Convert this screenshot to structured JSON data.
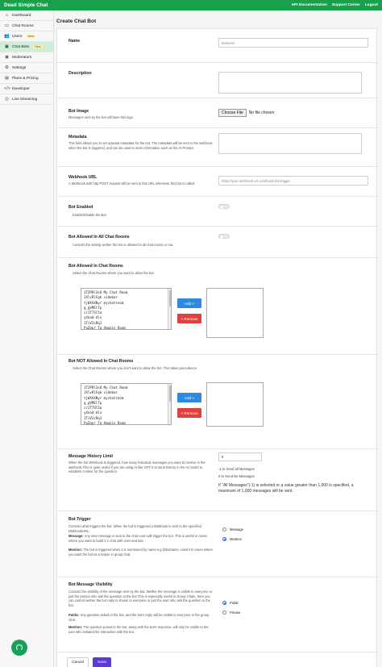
{
  "header": {
    "brand": "Dead Simple Chat",
    "nav": [
      "API Documentation",
      "Support Center",
      "Logout"
    ]
  },
  "sidebar": {
    "items": [
      {
        "icon": "home-icon",
        "glyph": "⌂",
        "label": "Dashboard",
        "badge": ""
      },
      {
        "icon": "chat-rooms-icon",
        "glyph": "▭",
        "label": "Chat Rooms",
        "badge": ""
      },
      {
        "icon": "users-icon",
        "glyph": "👥",
        "label": "Users",
        "badge": "New"
      },
      {
        "icon": "bot-icon",
        "glyph": "▣",
        "label": "Chat Bots",
        "badge": "New",
        "active": true
      },
      {
        "icon": "moderators-icon",
        "glyph": "◉",
        "label": "Moderators",
        "badge": ""
      },
      {
        "icon": "settings-icon",
        "glyph": "⚙",
        "label": "Settings",
        "badge": ""
      },
      {
        "icon": "plans-icon",
        "glyph": "▤",
        "label": "Plans & Pricing",
        "badge": ""
      },
      {
        "icon": "developer-icon",
        "glyph": "</>",
        "label": "Developer",
        "badge": ""
      },
      {
        "icon": "live-streaming-icon",
        "glyph": "◎",
        "label": "Live streaming",
        "badge": ""
      }
    ]
  },
  "page": {
    "title": "Create Chat Bot"
  },
  "form": {
    "name": {
      "label": "Name",
      "placeholder": "botname"
    },
    "description": {
      "label": "Description"
    },
    "image": {
      "label": "Bot Image",
      "desc": "Messages sent by the bot will have this logo",
      "button": "Choose File",
      "status": "No file chosen"
    },
    "metadata": {
      "label": "Metadata",
      "desc": "This field allows you to set optional metadata for the bot. The metadata will be sent in the webhook when the bot is triggered, and can be used to store information such as the AI Prompt."
    },
    "webhook": {
      "label": "Webhook URL",
      "desc": "A Webhook with http POST request will be sent to this URL whenever this bot is called.",
      "placeholder": "https://your-webhook-url.com/hand-bot-trigger"
    },
    "enabled": {
      "label": "Bot Enabled",
      "desc": "Enable/Disable the Bot."
    },
    "all_rooms": {
      "label": "Bot Allowed In All Chat Rooms",
      "desc": "Controls the setting wether the bot is allowed in all chat rooms or not."
    },
    "allowed_rooms": {
      "label": "Bot Allowed In Chat Rooms",
      "desc": "Select the Chat Rooms where you want to allow the bot",
      "rooms": [
        "1T2PRl3sO My Chat Room",
        "JXlvRlFgk sidebar",
        "tjWXAXNyr mychatroom",
        "g_gVMElTp",
        "crJT7Sl5a",
        "yXnad-dlv",
        "1TiV2cRqJ",
        "PuZgpr_Tq Amazin Room"
      ],
      "add": "Add >",
      "remove": "< Remove"
    },
    "not_allowed_rooms": {
      "label": "Bot NOT Allowed In Chat Rooms",
      "desc": "Select the Chat Rooms where you don't want to allow the bot. This takes precedence",
      "rooms": [
        "1T2PRl3sO My Chat Room",
        "JXlvRlFgk sidebar",
        "tjWXAXNyr mychatroom",
        "g_gVMElTp",
        "crJT7Sl5a",
        "yXnad-dlv",
        "1TiV2cRqJ",
        "PuZgpr_Tq Amazin Room"
      ],
      "add": "Add >",
      "remove": "< Remove"
    },
    "history": {
      "label": "Message History Limit",
      "desc": "When the bot Webhook is triggered, how many historical messages you want to receive in the webhook.This is quite useful if you are using AI like GPT-4 to send history to the AI model to establish context for the question.",
      "value": "0",
      "hint1": "-1 to Send all Messages",
      "hint2": "0 to Send No Messages",
      "note": "If \"All Messages\"(-1) is selected or a value greater than 1,000 is specified, a maximum of 1,000 messages will be sent."
    },
    "trigger": {
      "label": "Bot Trigger",
      "desc": "Controls what triggers the bot. When the bot is triggered a Webhook is sent to the specified WebhookURL.",
      "message_title": "Message:",
      "message_desc": " Any new message is sent in the chat room will trigger the bot. This is useful in cases where you want to build 1-1 chat with User and Bot.",
      "mention_title": "Mention:",
      "mention_desc": " The bot is triggered when it is mentioned by name e.g @botname. Useful in cases where you want the bot as a helper in group chat.",
      "options": [
        "Message",
        "Mention"
      ],
      "selected": "Mention"
    },
    "visibility": {
      "label": "Bot Message Visibility",
      "desc": "Controls the visibility of the message sent by the bot. Wether the message is visible to everyone or just the person who ask the question to the bot.This is especially useful in Group Chats, here you can control wether the bot reply is shown to everyone or just the user who ask the question to the bot.",
      "public_title": "Public:",
      "public_desc": " Any question asked to the bot, and the bot's reply will be visible to everyone in the group chat.",
      "mention_title": "Mention:",
      "mention_desc": " The question posed to the bot, along with the bot's response, will only be visible to the user who initiated the interaction with the bot.",
      "options": [
        "Public",
        "Private"
      ],
      "selected": "Public"
    },
    "cancel": "Cancel",
    "save": "Save"
  }
}
